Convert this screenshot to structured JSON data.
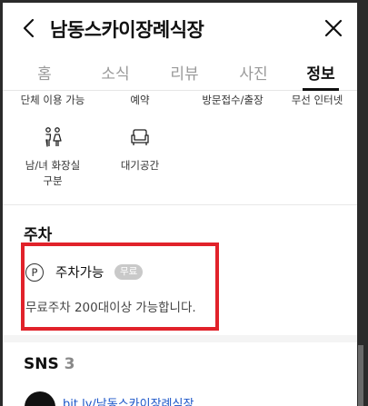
{
  "header": {
    "title": "남동스카이장례식장",
    "back_icon": "chevron-left-icon",
    "close_icon": "close-icon"
  },
  "tabs": [
    {
      "label": "홈",
      "active": false
    },
    {
      "label": "소식",
      "active": false
    },
    {
      "label": "리뷰",
      "active": false
    },
    {
      "label": "사진",
      "active": false
    },
    {
      "label": "정보",
      "active": true
    }
  ],
  "facilities_row1": [
    "단체 이용 가능",
    "예약",
    "방문접수/출장",
    "무선 인터넷"
  ],
  "facilities_row2": [
    {
      "icon": "restroom-icon",
      "label_line1": "남/녀 화장실",
      "label_line2": "구분"
    },
    {
      "icon": "sofa-icon",
      "label_line1": "대기공간",
      "label_line2": ""
    }
  ],
  "parking": {
    "title": "주차",
    "icon_glyph": "P",
    "label": "주차가능",
    "badge": "무료",
    "description": "무료주차 200대이상 가능합니다."
  },
  "sns": {
    "title": "SNS",
    "count": "3",
    "first_link": "bit.ly/남동스카이장례식장"
  },
  "colors": {
    "highlight_border": "#e1222a",
    "link": "#1a55c8",
    "badge_bg": "#c9c9c9"
  }
}
